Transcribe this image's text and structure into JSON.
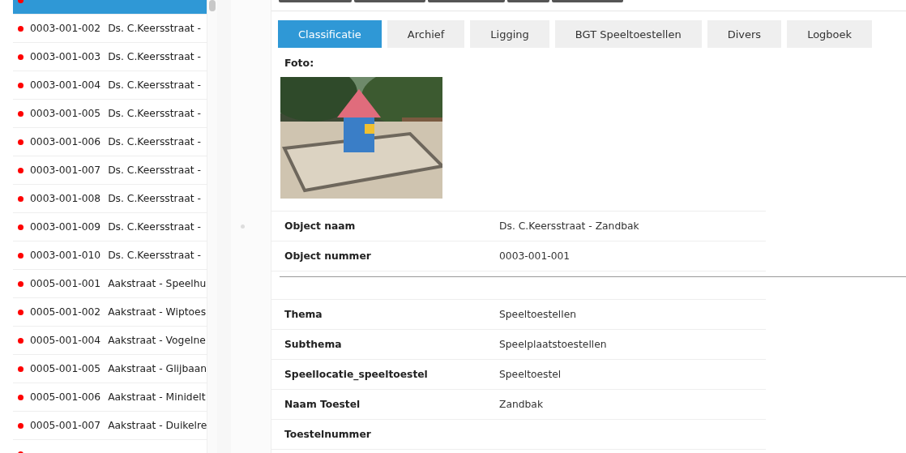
{
  "object_list": [
    {
      "selected": true,
      "color": "#ff0000"
    },
    {
      "number": "0003-001-002",
      "name": "Ds. C.Keersstraat -",
      "selected": false,
      "color": "#ff0000"
    },
    {
      "number": "0003-001-003",
      "name": "Ds. C.Keersstraat -",
      "selected": false,
      "color": "#ff0000"
    },
    {
      "number": "0003-001-004",
      "name": "Ds. C.Keersstraat -",
      "selected": false,
      "color": "#ff0000"
    },
    {
      "number": "0003-001-005",
      "name": "Ds. C.Keersstraat -",
      "selected": false,
      "color": "#ff0000"
    },
    {
      "number": "0003-001-006",
      "name": "Ds. C.Keersstraat -",
      "selected": false,
      "color": "#ff0000"
    },
    {
      "number": "0003-001-007",
      "name": "Ds. C.Keersstraat -",
      "selected": false,
      "color": "#ff0000"
    },
    {
      "number": "0003-001-008",
      "name": "Ds. C.Keersstraat -",
      "selected": false,
      "color": "#ff0000"
    },
    {
      "number": "0003-001-009",
      "name": "Ds. C.Keersstraat -",
      "selected": false,
      "color": "#ff0000"
    },
    {
      "number": "0003-001-010",
      "name": "Ds. C.Keersstraat -",
      "selected": false,
      "color": "#ff0000"
    },
    {
      "number": "0005-001-001",
      "name": "Aakstraat - Speelhu",
      "selected": false,
      "color": "#ff0000"
    },
    {
      "number": "0005-001-002",
      "name": "Aakstraat - Wiptoes",
      "selected": false,
      "color": "#ff0000"
    },
    {
      "number": "0005-001-004",
      "name": "Aakstraat - Vogelne",
      "selected": false,
      "color": "#ff0000"
    },
    {
      "number": "0005-001-005",
      "name": "Aakstraat - Glijbaan",
      "selected": false,
      "color": "#ff0000"
    },
    {
      "number": "0005-001-006",
      "name": "Aakstraat - Minidelt",
      "selected": false,
      "color": "#ff0000"
    },
    {
      "number": "0005-001-007",
      "name": "Aakstraat - Duikelre",
      "selected": false,
      "color": "#ff0000"
    },
    {
      "selected": false,
      "color": "#ff0000"
    }
  ],
  "tabs": [
    {
      "label": "Classificatie",
      "selected": true
    },
    {
      "label": "Archief",
      "selected": false
    },
    {
      "label": "Ligging",
      "selected": false
    },
    {
      "label": "BGT Speeltoestellen",
      "selected": false
    },
    {
      "label": "Divers",
      "selected": false
    },
    {
      "label": "Logboek",
      "selected": false
    }
  ],
  "photo": {
    "label": "Foto:",
    "kind": "picture"
  },
  "object_fields": [
    {
      "label": "Object naam",
      "value": "Ds. C.Keersstraat - Zandbak"
    },
    {
      "label": "Object nummer",
      "value": "0003-001-001"
    }
  ],
  "class_fields": [
    {
      "label": "Thema",
      "value": "Speeltoestellen"
    },
    {
      "label": "Subthema",
      "value": "Speelplaatstoestellen"
    },
    {
      "label": "Speellocatie_speeltoestel",
      "value": "Speeltoestel"
    },
    {
      "label": "Naam Toestel",
      "value": "Zandbak"
    },
    {
      "label": "Toestelnummer"
    }
  ]
}
